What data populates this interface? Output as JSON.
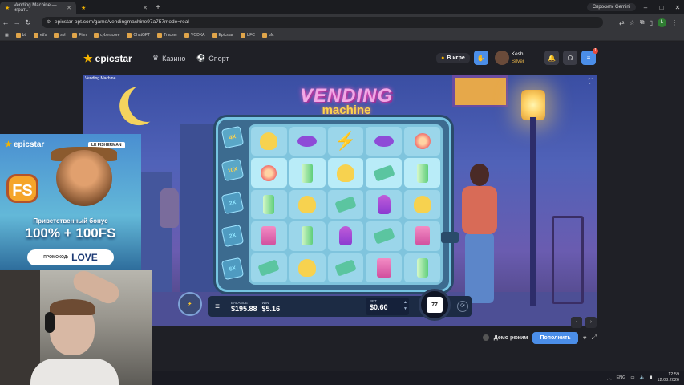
{
  "browser": {
    "tabs": [
      {
        "title": "Vending Machine — играть",
        "active": true
      },
      {
        "title": "",
        "active": false
      }
    ],
    "new_tab": "+",
    "ask_gemini": "Спросить Gemini",
    "url": "epicstar-opt.com/game/vendingmachine97a757mode=real",
    "profile_letter": "L",
    "bookmarks": [
      "bti",
      "etfs",
      "sol",
      "Film",
      "cyberscore",
      "ChatGPT",
      "Tracker",
      "VODKA",
      "Epicstar",
      "UFC",
      "ufc"
    ]
  },
  "site": {
    "logo": "epicstar",
    "nav": [
      {
        "label": "Казино",
        "icon": "crown-icon"
      },
      {
        "label": "Спорт",
        "icon": "ball-icon"
      }
    ],
    "in_game_label": "В игре",
    "user": {
      "name": "Kesh",
      "rank": "Silver"
    },
    "notification_count": "1"
  },
  "game": {
    "small_title": "Vending Machine",
    "title_top": "VENDING",
    "title_bottom": "machine",
    "multipliers": [
      "4X",
      "10X",
      "2X",
      "2X",
      "6X"
    ],
    "reels": [
      [
        "cheese",
        "candy",
        "bolt",
        "candy",
        "lolli"
      ],
      [
        "lolli",
        "can",
        "cheese",
        "cash",
        "can"
      ],
      [
        "can",
        "cheese",
        "cash",
        "ice",
        "cheese"
      ],
      [
        "milk",
        "can",
        "ice",
        "cash",
        "milk"
      ],
      [
        "cash",
        "cheese",
        "cash",
        "milk",
        "can"
      ]
    ],
    "balance_label": "BALANCE",
    "balance": "$195.88",
    "win_label": "WIN",
    "win": "$5.16",
    "bet_label": "BET",
    "bet": "$0.60",
    "spin_count": "77"
  },
  "footer": {
    "demo_label": "Демо режим",
    "deposit_label": "Пополнить"
  },
  "promo": {
    "logo": "epicstar",
    "tag": "LE FISHERMAN",
    "badge": "FS",
    "welcome": "Приветственный бонус",
    "offer": "100% + 100FS",
    "code_label": "ПРОМОКОД:",
    "code": "LOVE"
  },
  "taskbar": {
    "lang": "ENG",
    "time": "12:59",
    "date": "12.08.2026"
  }
}
